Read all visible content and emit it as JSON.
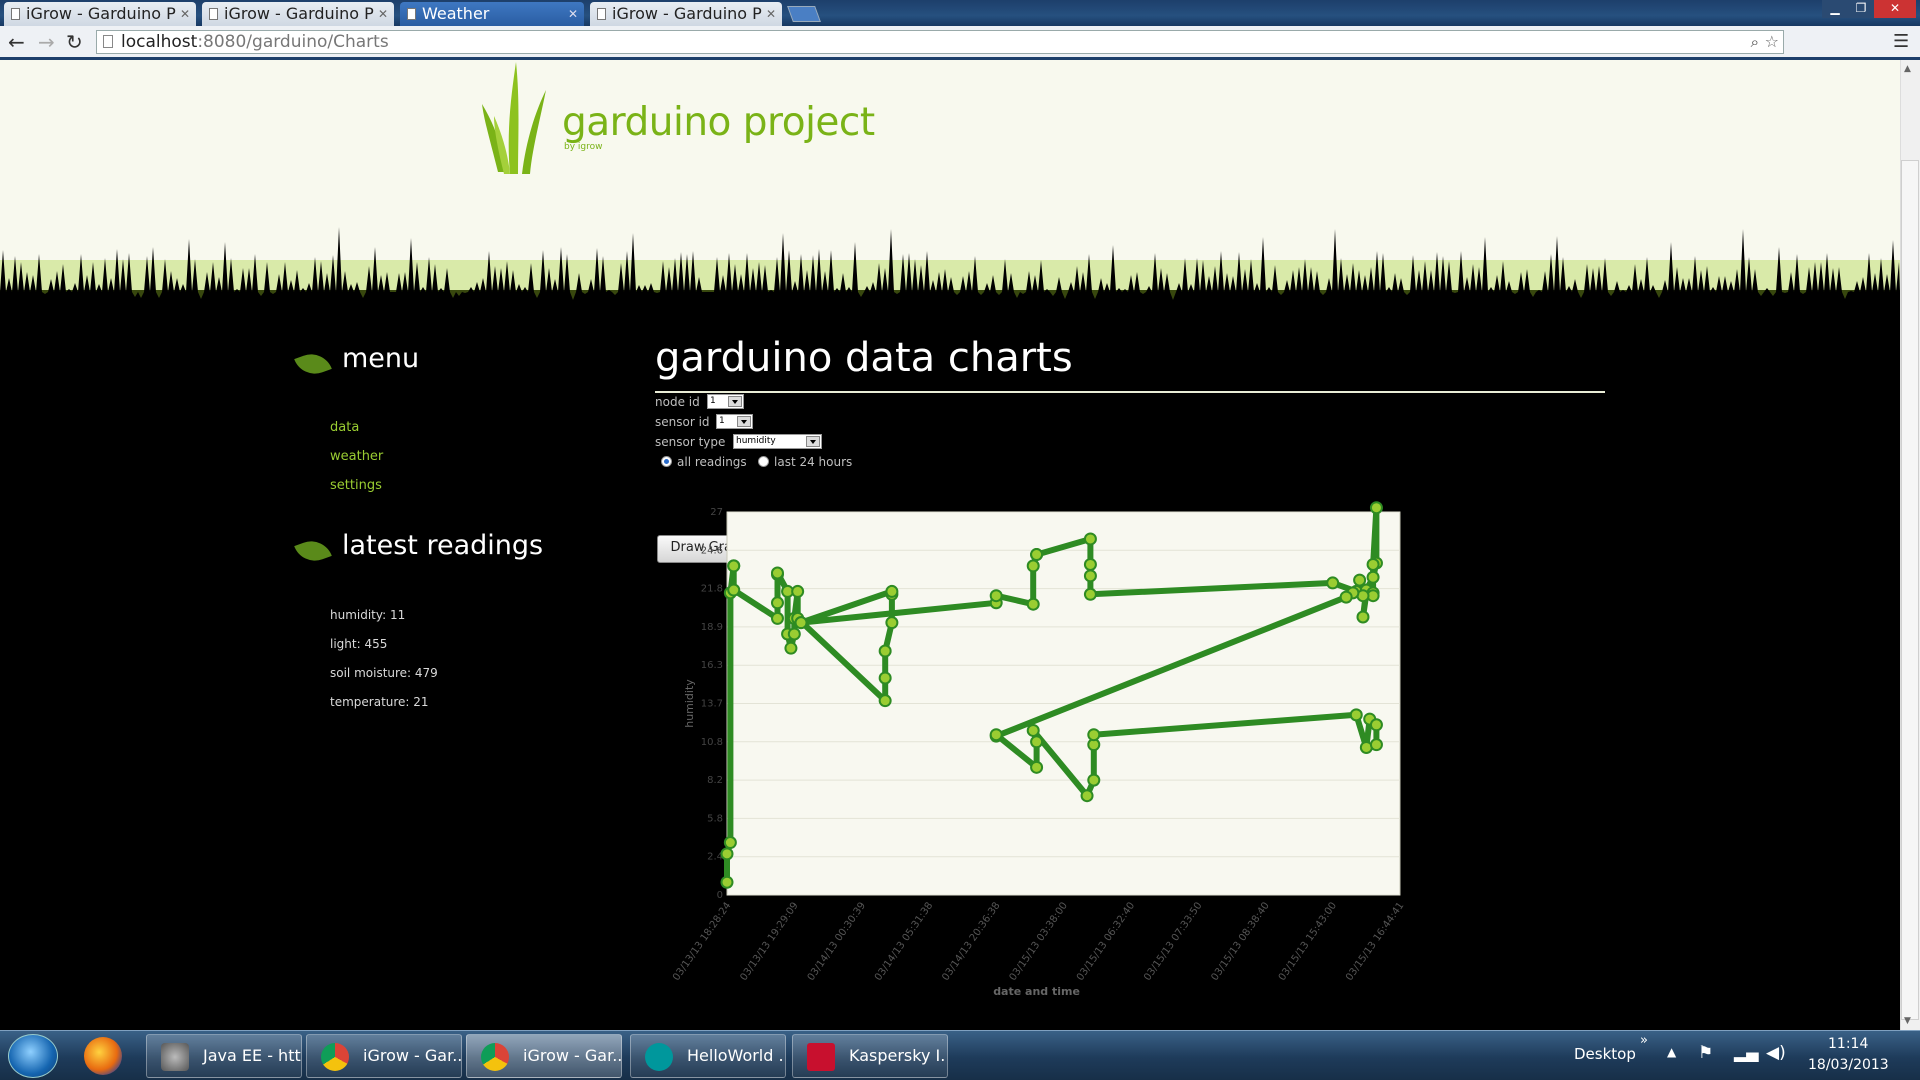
{
  "browser": {
    "tabs": [
      {
        "label": "iGrow - Garduino P"
      },
      {
        "label": "iGrow - Garduino P"
      },
      {
        "label": "Weather"
      },
      {
        "label": "iGrow - Garduino P"
      }
    ],
    "url_host": "localhost",
    "url_rest": ":8080/garduino/Charts"
  },
  "site": {
    "logo_title": "garduino project",
    "logo_sub": "by igrow"
  },
  "sidebar": {
    "menu_heading": "menu",
    "menu_items": [
      {
        "label": "data"
      },
      {
        "label": "weather"
      },
      {
        "label": "settings"
      }
    ],
    "readings_heading": "latest readings",
    "readings": [
      {
        "text": "humidity: 11"
      },
      {
        "text": "light: 455"
      },
      {
        "text": "soil moisture: 479"
      },
      {
        "text": "temperature: 21"
      }
    ]
  },
  "main": {
    "title": "garduino data charts",
    "node_label": "node id",
    "node_value": "1",
    "sensor_label": "sensor id",
    "sensor_value": "1",
    "type_label": "sensor type",
    "type_value": "humidity",
    "radio_all": "all readings",
    "radio_24h": "last 24 hours",
    "draw_button": "Draw Graph"
  },
  "chart_data": {
    "type": "line",
    "title": "",
    "xlabel": "date and time",
    "ylabel": "humidity",
    "ylim": [
      0,
      27
    ],
    "yticks": [
      0,
      2.7,
      5.4,
      8.1,
      10.8,
      13.5,
      16.2,
      18.9,
      21.6,
      24.3,
      27
    ],
    "ytick_labels": [
      "0",
      "2.4",
      "5.8",
      "8.2",
      "10.8",
      "13.7",
      "16.3",
      "18.9",
      "21.8",
      "24.6",
      "27"
    ],
    "xtick_labels": [
      "03/13/13 18:28:24",
      "03/13/13 19:29:09",
      "03/14/13 00:30:39",
      "03/14/13 05:31:38",
      "03/14/13 20:36:38",
      "03/15/13 03:38:00",
      "03/15/13 06:32:40",
      "03/15/13 07:33:50",
      "03/15/13 08:38:40",
      "03/15/13 15:43:00",
      "03/15/13 16:44:41"
    ],
    "xlim": [
      0,
      10
    ],
    "grid": true,
    "color": "#2e8b23",
    "marker_color": "#9acd32",
    "x": [
      0.0,
      0.0,
      0.05,
      0.05,
      0.1,
      0.1,
      0.1,
      0.75,
      0.75,
      0.75,
      0.75,
      0.9,
      0.9,
      0.95,
      1.0,
      1.0,
      1.05,
      1.05,
      2.35,
      2.35,
      2.35,
      2.45,
      2.45,
      2.45,
      1.1,
      1.1,
      4.0,
      4.0,
      4.55,
      4.55,
      4.6,
      4.6,
      5.4,
      5.4,
      5.4,
      5.4,
      9.0,
      9.35,
      9.4,
      9.5,
      9.45,
      9.5,
      9.6,
      9.65,
      9.65,
      9.6,
      9.6,
      9.6,
      9.45,
      9.3,
      9.2,
      4.0,
      4.0,
      4.6,
      4.6,
      4.55,
      5.35,
      5.45,
      5.45,
      5.45,
      9.35,
      9.5,
      9.55,
      9.65,
      9.65
    ],
    "y": [
      0.9,
      2.9,
      3.7,
      21.3,
      23.2,
      23.2,
      21.5,
      19.5,
      20.6,
      22.6,
      22.7,
      21.4,
      18.4,
      17.4,
      18.4,
      19.5,
      21.4,
      19.5,
      13.7,
      15.3,
      17.2,
      19.2,
      21.2,
      21.4,
      19.2,
      19.2,
      20.6,
      21.1,
      20.5,
      23.2,
      24.0,
      24.0,
      25.1,
      23.3,
      22.5,
      21.2,
      22.0,
      21.4,
      22.2,
      21.2,
      19.6,
      21.5,
      22.4,
      23.4,
      27.3,
      23.3,
      21.3,
      21.1,
      21.1,
      21.3,
      21.0,
      11.2,
      11.3,
      9.0,
      10.8,
      11.6,
      7.0,
      8.1,
      10.6,
      11.3,
      12.7,
      10.4,
      12.4,
      12.0,
      10.6
    ]
  }
}
